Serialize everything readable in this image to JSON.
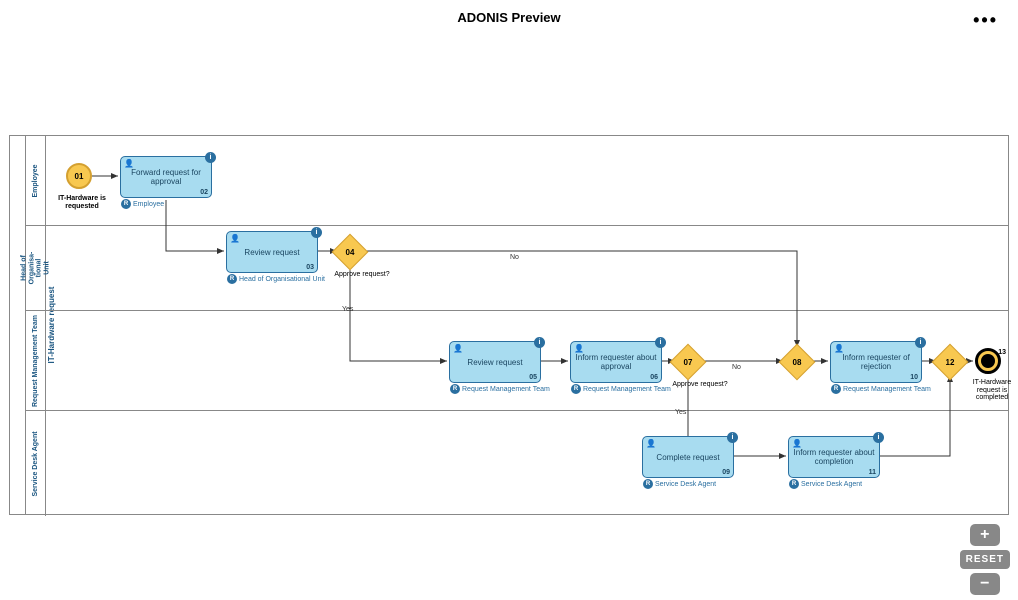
{
  "header": {
    "title": "ADONIS Preview",
    "more": "•••"
  },
  "pool": {
    "name": "IT-Hardware request"
  },
  "lanes": [
    {
      "name": "Employee"
    },
    {
      "name": "Head of Organisa-\ntional Unit"
    },
    {
      "name": "Request Management Team"
    },
    {
      "name": "Service Desk Agent"
    }
  ],
  "events": {
    "start": {
      "num": "01",
      "label": "IT-Hardware is requested"
    },
    "end": {
      "num": "13",
      "label": "IT-Hardware request is completed"
    }
  },
  "tasks": {
    "t02": {
      "label": "Forward request for approval",
      "num": "02",
      "role": "Employee"
    },
    "t03": {
      "label": "Review request",
      "num": "03",
      "role": "Head of Organisational Unit"
    },
    "t05": {
      "label": "Review request",
      "num": "05",
      "role": "Request Management Team"
    },
    "t06": {
      "label": "Inform requester about approval",
      "num": "06",
      "role": "Request Management Team"
    },
    "t09": {
      "label": "Complete request",
      "num": "09",
      "role": "Service Desk Agent"
    },
    "t10": {
      "label": "Inform requester of rejection",
      "num": "10",
      "role": "Request Management Team"
    },
    "t11": {
      "label": "Inform requester about completion",
      "num": "11",
      "role": "Service Desk Agent"
    }
  },
  "gateways": {
    "g04": {
      "num": "04",
      "label": "Approve request?"
    },
    "g07": {
      "num": "07",
      "label": "Approve request?"
    },
    "g08": {
      "num": "08"
    },
    "g12": {
      "num": "12"
    }
  },
  "flowLabels": {
    "yes1": "Yes",
    "no1": "No",
    "yes2": "Yes",
    "no2": "No"
  },
  "zoom": {
    "in": "+",
    "out": "−",
    "reset": "RESET"
  }
}
